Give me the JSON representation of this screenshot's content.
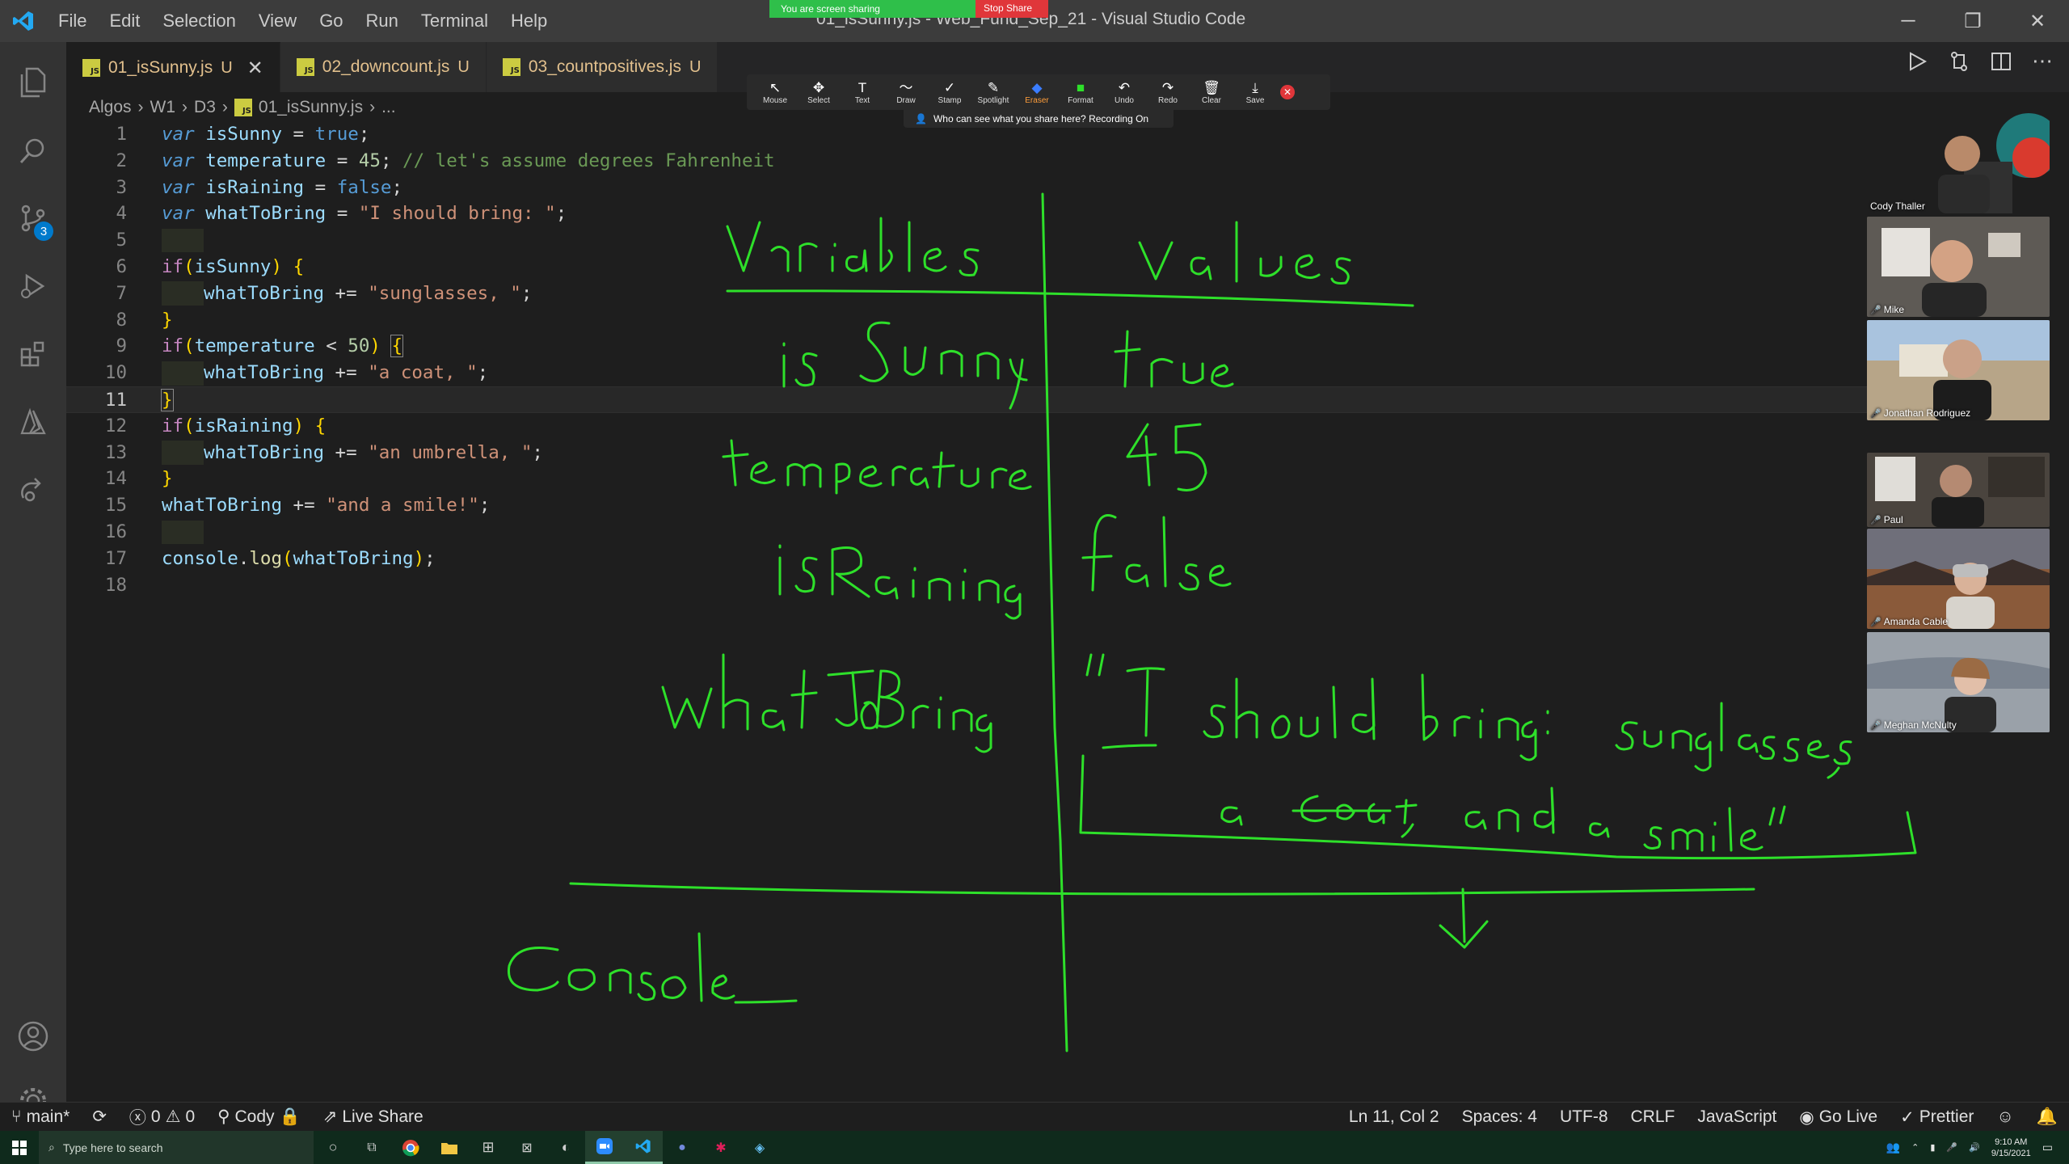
{
  "window": {
    "title": "01_isSunny.js - Web_Fund_Sep_21 - Visual Studio Code",
    "menu": [
      "File",
      "Edit",
      "Selection",
      "View",
      "Go",
      "Run",
      "Terminal",
      "Help"
    ]
  },
  "share_banner": {
    "status": "You are screen sharing",
    "stop": "Stop Share"
  },
  "activity_bar": {
    "scm_badge": "3"
  },
  "tabs": [
    {
      "label": "01_isSunny.js",
      "flag": "U",
      "active": true
    },
    {
      "label": "02_downcount.js",
      "flag": "U",
      "active": false
    },
    {
      "label": "03_countpositives.js",
      "flag": "U",
      "active": false
    }
  ],
  "breadcrumb": [
    "Algos",
    "W1",
    "D3",
    "01_isSunny.js",
    "..."
  ],
  "code": {
    "lines": [
      "1",
      "2",
      "3",
      "4",
      "5",
      "6",
      "7",
      "8",
      "9",
      "10",
      "11",
      "12",
      "13",
      "14",
      "15",
      "16",
      "17",
      "18"
    ],
    "t": {
      "var": "var",
      "isSunny": "isSunny",
      "temperature": "temperature",
      "isRaining": "isRaining",
      "whatToBring": "whatToBring",
      "eq": " = ",
      "semi": ";",
      "true": "true",
      "false": "false",
      "n45": "45",
      "n50": "50",
      "cmt": "// let's assume degrees Fahrenheit",
      "s_bring": "\"I should bring: \"",
      "s_sun": "\"sunglasses, \"",
      "s_coat": "\"a coat, \"",
      "s_umb": "\"an umbrella, \"",
      "s_smile": "\"and a smile!\"",
      "if": "if",
      "lp": "(",
      "rp": ")",
      "lb": "{",
      "rb": "}",
      "sp": " ",
      "pluseq": " += ",
      "lt": " < ",
      "console": "console",
      "dot": ".",
      "log": "log"
    }
  },
  "annotation_toolbar": {
    "tools": [
      {
        "icon": "↖",
        "label": "Mouse"
      },
      {
        "icon": "✥",
        "label": "Select"
      },
      {
        "icon": "T",
        "label": "Text"
      },
      {
        "icon": "〜",
        "label": "Draw"
      },
      {
        "icon": "✓",
        "label": "Stamp"
      },
      {
        "icon": "✎",
        "label": "Spotlight"
      },
      {
        "icon": "◆",
        "label": "Eraser"
      },
      {
        "icon": "■",
        "label": "Format"
      },
      {
        "icon": "↶",
        "label": "Undo"
      },
      {
        "icon": "↷",
        "label": "Redo"
      },
      {
        "icon": "🗑",
        "label": "Clear"
      },
      {
        "icon": "⤓",
        "label": "Save"
      }
    ],
    "notice": "Who can see what you share here? Recording On"
  },
  "participants": [
    {
      "name": "Cody Thaller"
    },
    {
      "name": "Mike"
    },
    {
      "name": "Jonathan Rodriguez"
    },
    {
      "name": "Paul"
    },
    {
      "name": "Amanda Cable"
    },
    {
      "name": "Meghan McNulty"
    }
  ],
  "status_bar": {
    "branch": "main*",
    "errors": "0",
    "warnings": "0",
    "user": "Cody",
    "live_share": "Live Share",
    "position": "Ln 11, Col 2",
    "spaces": "Spaces: 4",
    "encoding": "UTF-8",
    "eol": "CRLF",
    "language": "JavaScript",
    "go_live": "Go Live",
    "prettier": "Prettier"
  },
  "taskbar": {
    "search_placeholder": "Type here to search",
    "time": "9:10 AM",
    "date": "9/15/2021"
  },
  "colors": {
    "ink": "#2ee02a",
    "accent": "#007acc"
  }
}
